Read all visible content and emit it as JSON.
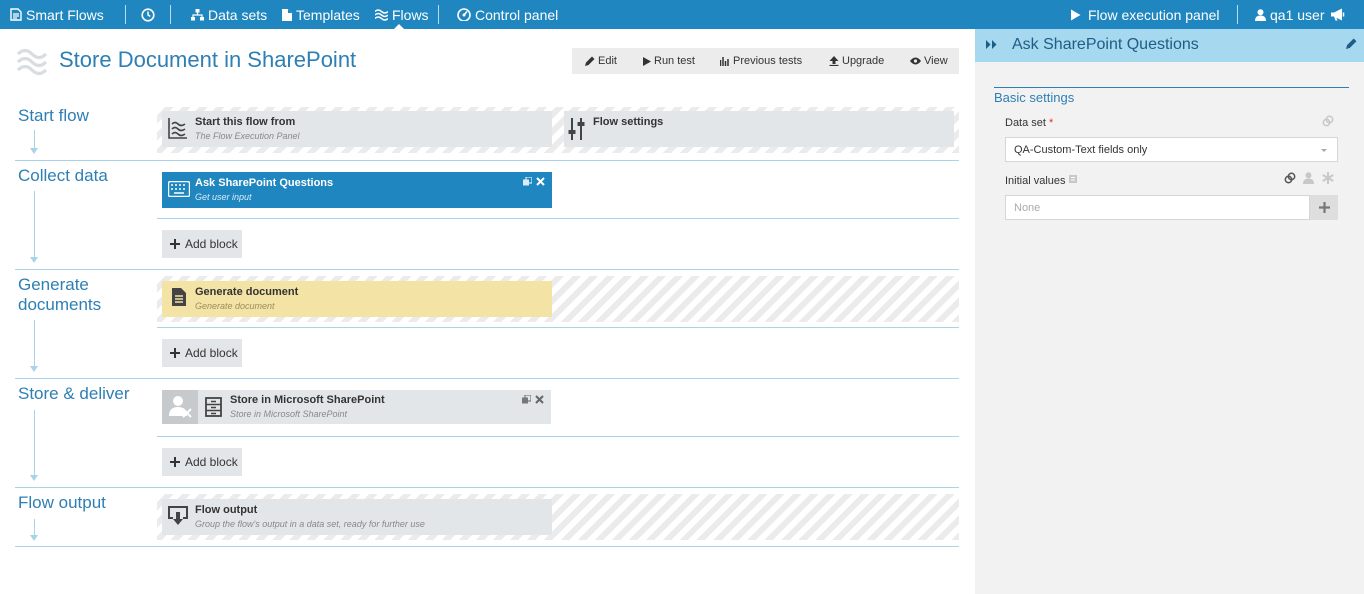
{
  "nav": {
    "brand": "Smart Flows",
    "data_sets": "Data sets",
    "templates": "Templates",
    "flows": "Flows",
    "control_panel": "Control panel",
    "flow_execution_panel": "Flow execution panel",
    "user": "qa1 user"
  },
  "page": {
    "title": "Store Document in SharePoint",
    "actions": {
      "edit": "Edit",
      "run_test": "Run test",
      "previous_tests": "Previous tests",
      "upgrade": "Upgrade",
      "view": "View"
    }
  },
  "stages": {
    "start": {
      "label": "Start flow",
      "blocks": [
        {
          "title": "Start this flow from",
          "subtitle": "The Flow Execution Panel"
        },
        {
          "title": "Flow settings"
        }
      ]
    },
    "collect": {
      "label": "Collect data",
      "block": {
        "title": "Ask SharePoint Questions",
        "subtitle": "Get user input"
      },
      "add_block": "Add block"
    },
    "generate": {
      "label": "Generate documents",
      "block": {
        "title": "Generate document",
        "subtitle": "Generate document"
      },
      "add_block": "Add block"
    },
    "store": {
      "label": "Store & deliver",
      "block": {
        "title": "Store in Microsoft SharePoint",
        "subtitle": "Store in Microsoft SharePoint"
      },
      "add_block": "Add block"
    },
    "output": {
      "label": "Flow output",
      "block": {
        "title": "Flow output",
        "subtitle": "Group the flow's output in a data set, ready for further use"
      }
    }
  },
  "panel": {
    "title": "Ask SharePoint Questions",
    "section": "Basic settings",
    "data_set_label": "Data set",
    "required_mark": "*",
    "data_set_value": "QA-Custom-Text fields only",
    "initial_values_label": "Initial values",
    "initial_values_placeholder": "None"
  },
  "colors": {
    "topbar": "#1f86bf",
    "accent": "#2e7fb4",
    "panel_header": "#a6d8ef",
    "document_block": "#f3e3a4"
  }
}
